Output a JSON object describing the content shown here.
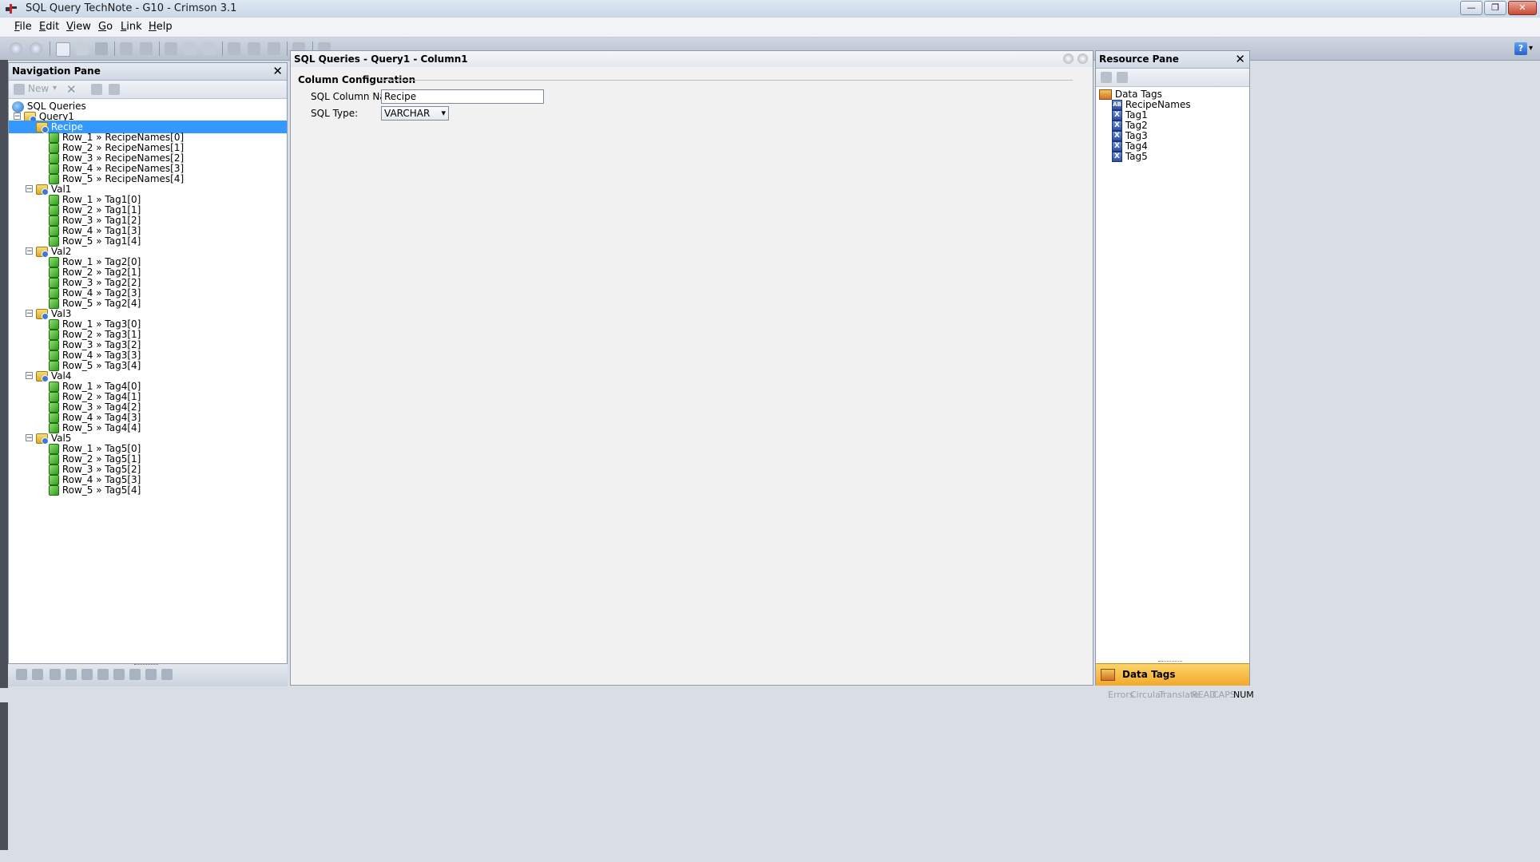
{
  "window": {
    "title": "SQL Query TechNote - G10 - Crimson 3.1",
    "minimize": "—",
    "restore": "❐",
    "close": "✕"
  },
  "menu": [
    "File",
    "Edit",
    "View",
    "Go",
    "Link",
    "Help"
  ],
  "menu_mnemonics": [
    "F",
    "E",
    "V",
    "G",
    "L",
    "H"
  ],
  "toolbar": {
    "help_icon": "?",
    "help_dropdown": "▾"
  },
  "navigation": {
    "title": "Navigation Pane",
    "close": "✕",
    "new_label": "New",
    "root": "SQL Queries",
    "query": "Query1",
    "columns": [
      {
        "name": "Recipe",
        "rows": [
          "Row_1 » RecipeNames[0]",
          "Row_2 » RecipeNames[1]",
          "Row_3 » RecipeNames[2]",
          "Row_4 » RecipeNames[3]",
          "Row_5 » RecipeNames[4]"
        ]
      },
      {
        "name": "Val1",
        "rows": [
          "Row_1 » Tag1[0]",
          "Row_2 » Tag1[1]",
          "Row_3 » Tag1[2]",
          "Row_4 » Tag1[3]",
          "Row_5 » Tag1[4]"
        ]
      },
      {
        "name": "Val2",
        "rows": [
          "Row_1 » Tag2[0]",
          "Row_2 » Tag2[1]",
          "Row_3 » Tag2[2]",
          "Row_4 » Tag2[3]",
          "Row_5 » Tag2[4]"
        ]
      },
      {
        "name": "Val3",
        "rows": [
          "Row_1 » Tag3[0]",
          "Row_2 » Tag3[1]",
          "Row_3 » Tag3[2]",
          "Row_4 » Tag3[3]",
          "Row_5 » Tag3[4]"
        ]
      },
      {
        "name": "Val4",
        "rows": [
          "Row_1 » Tag4[0]",
          "Row_2 » Tag4[1]",
          "Row_3 » Tag4[2]",
          "Row_4 » Tag4[3]",
          "Row_5 » Tag4[4]"
        ]
      },
      {
        "name": "Val5",
        "rows": [
          "Row_1 » Tag5[0]",
          "Row_2 » Tag5[1]",
          "Row_3 » Tag5[2]",
          "Row_4 » Tag5[3]",
          "Row_5 » Tag5[4]"
        ]
      }
    ],
    "selected": "Recipe",
    "expander_symbol": "−"
  },
  "editor": {
    "header": "SQL Queries - Query1 - Column1",
    "section_title": "Column Configuration",
    "column_name_label": "SQL Column Name:",
    "column_name_value": "Recipe",
    "sql_type_label": "SQL Type:",
    "sql_type_value": "VARCHAR",
    "dropdown_arrow": "▾"
  },
  "resource": {
    "title": "Resource Pane",
    "close": "✕",
    "root": "Data Tags",
    "tags": [
      {
        "name": "RecipeNames",
        "badge": "AB"
      },
      {
        "name": "Tag1",
        "badge": "X"
      },
      {
        "name": "Tag2",
        "badge": "X"
      },
      {
        "name": "Tag3",
        "badge": "X"
      },
      {
        "name": "Tag4",
        "badge": "X"
      },
      {
        "name": "Tag5",
        "badge": "X"
      }
    ],
    "bottom_tab": "Data Tags"
  },
  "status": [
    "Errors",
    "Circular",
    "Translate",
    "READ",
    "CAPS",
    "NUM"
  ],
  "colors": {
    "selection": "#3399ff",
    "tab_orange": "#f6b737",
    "status_active": "#000000"
  }
}
